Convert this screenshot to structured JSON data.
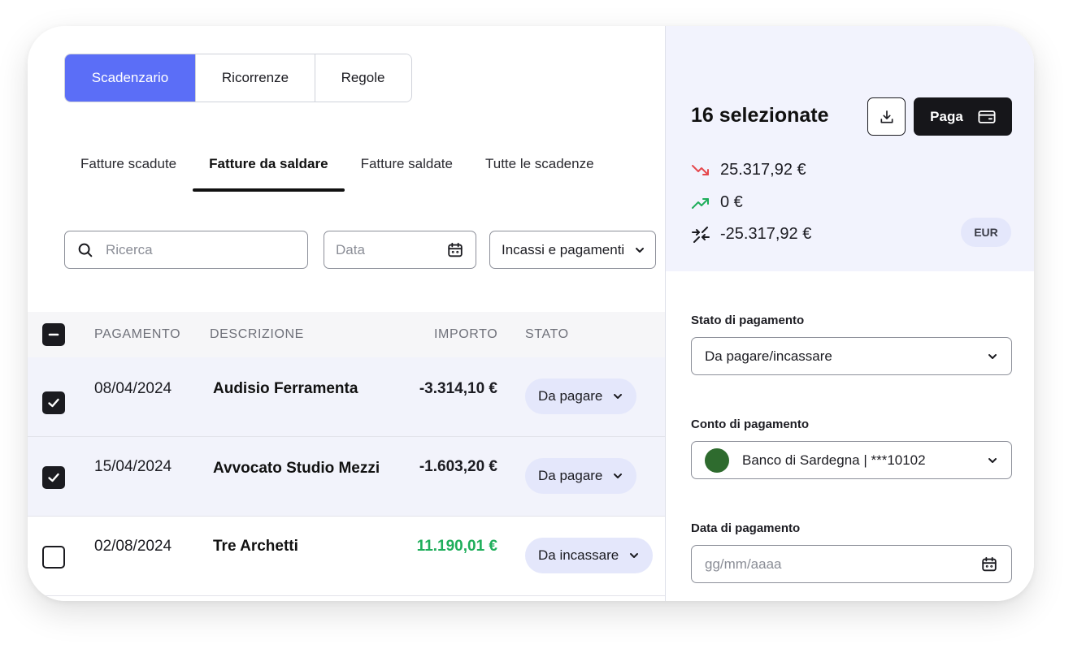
{
  "view_tabs": [
    {
      "label": "Scadenzario",
      "active": true
    },
    {
      "label": "Ricorrenze",
      "active": false
    },
    {
      "label": "Regole",
      "active": false
    }
  ],
  "sub_tabs": [
    {
      "label": "Fatture scadute",
      "active": false
    },
    {
      "label": "Fatture da saldare",
      "active": true
    },
    {
      "label": "Fatture saldate",
      "active": false
    },
    {
      "label": "Tutte le scadenze",
      "active": false
    }
  ],
  "filters": {
    "search_placeholder": "Ricerca",
    "date_placeholder": "Data",
    "type_select": "Incassi e pagamenti"
  },
  "table": {
    "headers": {
      "payment": "PAGAMENTO",
      "description": "DESCRIZIONE",
      "amount": "IMPORTO",
      "status": "STATO"
    },
    "rows": [
      {
        "checked": true,
        "date": "08/04/2024",
        "description": "Audisio Ferramenta",
        "amount": "-3.314,10 €",
        "amount_color": "#1c1c22",
        "status": "Da pagare"
      },
      {
        "checked": true,
        "date": "15/04/2024",
        "description": "Avvocato Studio Mezzi",
        "amount": "-1.603,20 €",
        "amount_color": "#1c1c22",
        "status": "Da pagare"
      },
      {
        "checked": false,
        "date": "02/08/2024",
        "description": "Tre Archetti",
        "amount": "11.190,01 €",
        "amount_color": "#1fae5b",
        "status": "Da incassare"
      }
    ]
  },
  "summary": {
    "selected_label": "16 selezionate",
    "pay_label": "Paga",
    "outgoing": "25.317,92 €",
    "incoming": "0 €",
    "net": "-25.317,92 €",
    "currency": "EUR",
    "outgoing_color": "#e5484d",
    "incoming_color": "#1fae5b"
  },
  "form": {
    "status_label": "Stato di pagamento",
    "status_value": "Da pagare/incassare",
    "account_label": "Conto di pagamento",
    "account_value": "Banco di Sardegna | ***10102",
    "date_label": "Data di pagamento",
    "date_placeholder": "gg/mm/aaaa"
  },
  "colors": {
    "accent": "#5b6ef7",
    "pill_bg": "#e4e7fb",
    "account_dot": "#2e6b2e"
  }
}
